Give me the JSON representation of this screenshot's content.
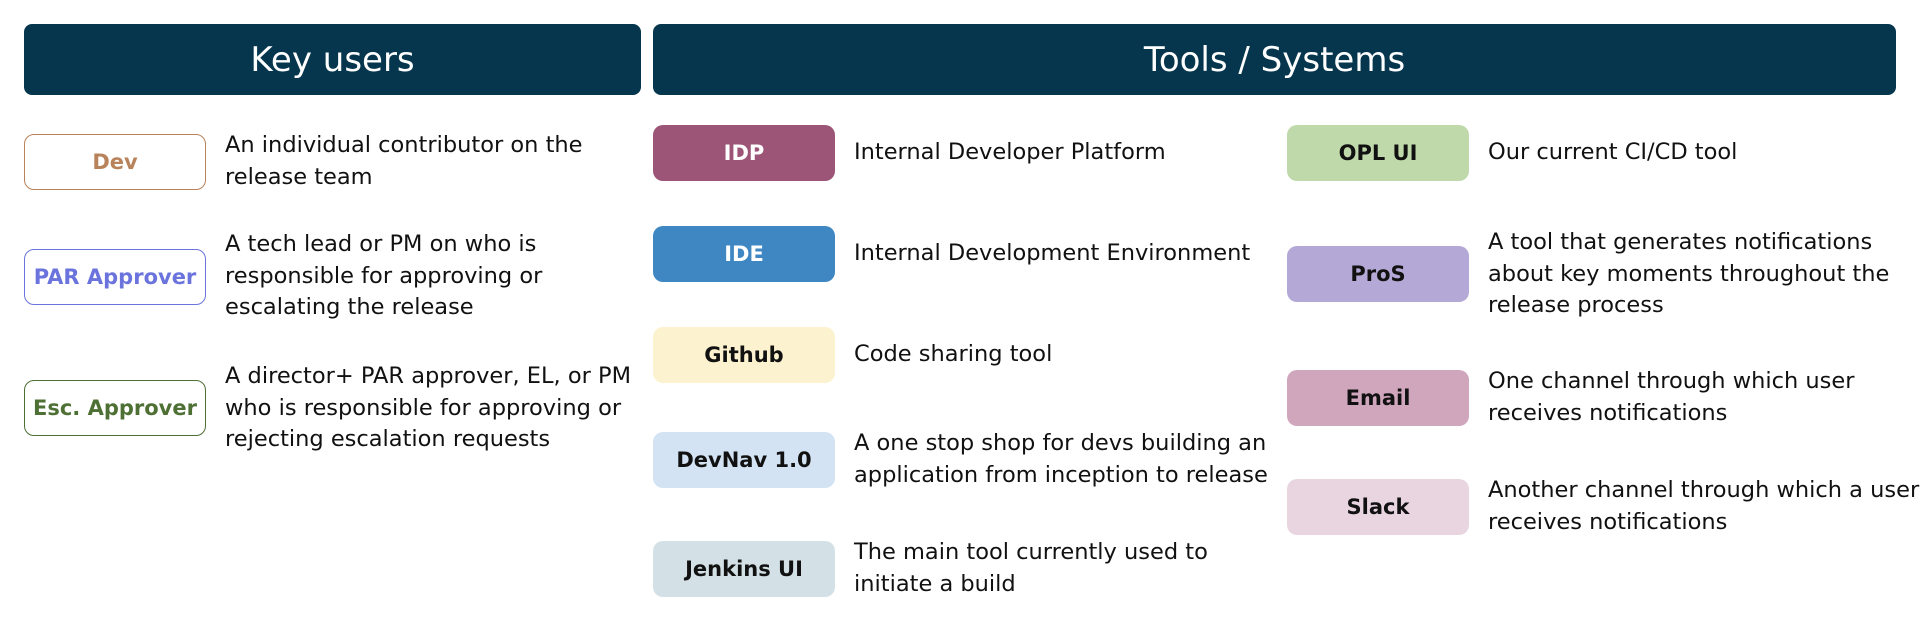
{
  "headers": {
    "users": "Key users",
    "tools": "Tools / Systems"
  },
  "colors": {
    "header_bg": "#05364d",
    "header_text": "#ffffff",
    "dev": "#b8825a",
    "par_approver": "#6b74dd",
    "esc_approver": "#4f7034"
  },
  "users": [
    {
      "label": "Dev",
      "color": "#b8825a",
      "description": [
        "An individual contributor on the",
        "release team"
      ]
    },
    {
      "label": "PAR Approver",
      "color": "#6b74dd",
      "description": [
        "A tech lead or PM on who is",
        "responsible for approving or",
        "escalating the release"
      ]
    },
    {
      "label": "Esc. Approver",
      "color": "#4f7034",
      "description": [
        "A director+ PAR approver, EL, or PM",
        "who is responsible for approving or",
        "rejecting escalation requests"
      ]
    }
  ],
  "tools_left": [
    {
      "label": "IDP",
      "bg": "#9c5577",
      "fg": "#ffffff",
      "description": [
        "Internal Developer Platform"
      ]
    },
    {
      "label": "IDE",
      "bg": "#3f87c2",
      "fg": "#ffffff",
      "description": [
        "Internal Development Environment"
      ]
    },
    {
      "label": "Github",
      "bg": "#fdf2cf",
      "fg": "#111111",
      "description": [
        "Code sharing tool"
      ]
    },
    {
      "label": "DevNav 1.0",
      "bg": "#d4e3f4",
      "fg": "#111111",
      "description": [
        "A one stop shop for devs building an",
        "application from inception to release"
      ]
    },
    {
      "label": "Jenkins UI",
      "bg": "#d3e0e5",
      "fg": "#111111",
      "description": [
        "The main tool currently used to",
        "initiate a build"
      ]
    }
  ],
  "tools_right": [
    {
      "label": "OPL UI",
      "bg": "#bfd9ab",
      "fg": "#111111",
      "description": [
        "Our current CI/CD tool"
      ]
    },
    {
      "label": "ProS",
      "bg": "#b4a9d6",
      "fg": "#111111",
      "description": [
        "A tool that generates notifications",
        "about key moments throughout the",
        "release process"
      ]
    },
    {
      "label": "Email",
      "bg": "#d0a6bd",
      "fg": "#111111",
      "description": [
        "One channel through which user",
        "receives notifications"
      ]
    },
    {
      "label": "Slack",
      "bg": "#e9d5e0",
      "fg": "#111111",
      "description": [
        "Another channel through which a user",
        "receives notifications"
      ]
    }
  ]
}
